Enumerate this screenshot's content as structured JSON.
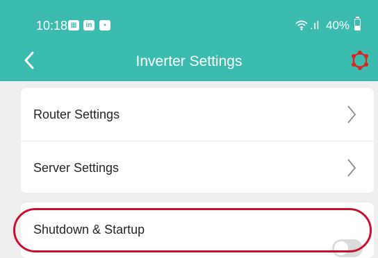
{
  "status_bar": {
    "time": "10:18",
    "notification_icons": [
      "calendar-icon",
      "linkedin-icon",
      "app-icon"
    ],
    "linkedin_glyph": "in",
    "signal_text": ".ıl",
    "battery": "40%",
    "battery_level": 0.4
  },
  "header": {
    "title": "Inverter Settings",
    "back_icon": "chevron-left-icon",
    "action_icon": "hexagon-icon"
  },
  "settings": {
    "router": {
      "label": "Router Settings"
    },
    "server": {
      "label": "Server Settings"
    },
    "shutdown": {
      "label": "Shutdown & Startup",
      "enabled": false
    }
  },
  "colors": {
    "header_bg": "#3bbcae",
    "accent_red": "#e0241f",
    "highlight_outline": "#c8102e",
    "page_bg": "#eeeeee"
  }
}
